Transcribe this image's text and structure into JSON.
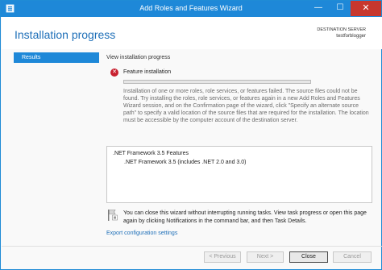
{
  "window": {
    "title": "Add Roles and Features Wizard",
    "minimize_glyph": "—",
    "maximize_glyph": "☐",
    "close_glyph": "✕",
    "accent_color": "#1e88d8",
    "app_icon": "server-manager-icon"
  },
  "header": {
    "page_title": "Installation progress",
    "destination_label": "DESTINATION SERVER",
    "destination_server": "testforblogger"
  },
  "sidebar": {
    "items": [
      {
        "label": "Results",
        "selected": true
      }
    ]
  },
  "main": {
    "section_label": "View installation progress",
    "status": {
      "icon": "error-icon",
      "icon_glyph": "✕",
      "label": "Feature installation",
      "message": "Installation of one or more roles, role services, or features failed. The source files could not be found. Try installing the roles, role services, or features again in a new Add Roles and Features Wizard session, and on the Confirmation page of the wizard, click \"Specify an alternate source path\" to specify a valid location of the source files that are required for the installation. The location must be accessible by the computer account of the destination server."
    },
    "results": [
      ".NET Framework 3.5 Features",
      ".NET Framework 3.5 (includes .NET 2.0 and 3.0)"
    ],
    "info_icon": "notification-flag-icon",
    "info_text": "You can close this wizard without interrupting running tasks. View task progress or open this page again by clicking Notifications in the command bar, and then Task Details.",
    "export_link": "Export configuration settings"
  },
  "footer": {
    "previous_label": "< Previous",
    "next_label": "Next >",
    "close_label": "Close",
    "cancel_label": "Cancel"
  }
}
